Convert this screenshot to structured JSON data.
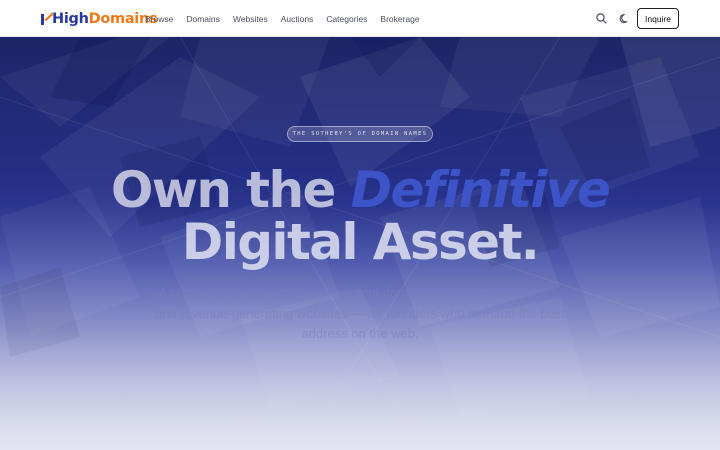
{
  "brand": {
    "part1": "High",
    "part2": "Domains",
    "accent": "#f07a18",
    "primary": "#2a3aa0"
  },
  "nav": {
    "items": [
      "Browse",
      "Domains",
      "Websites",
      "Auctions",
      "Categories",
      "Brokerage"
    ]
  },
  "header": {
    "search_icon": "search-icon",
    "theme_icon": "moon-icon",
    "inquire_label": "Inquire"
  },
  "hero": {
    "tagline": "THE SOTHEBY'S OF DOMAIN NAMES",
    "headline_part1": "Own the ",
    "headline_accent": "Definitive",
    "headline_line2": "Digital Asset.",
    "subtitle": "A curated showcase of one-word .com domains, premium brandables, and revenue-generating websites — for founders who demand the best address on the web."
  }
}
